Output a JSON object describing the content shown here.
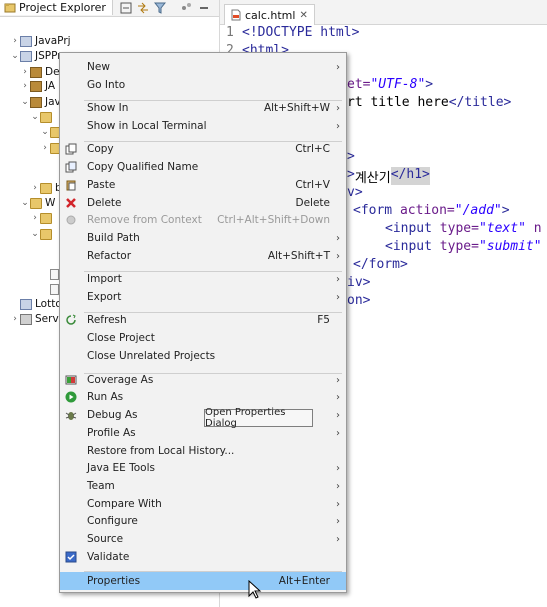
{
  "explorer": {
    "tab_title": "Project Explorer",
    "rows": [
      {
        "twisty": "›",
        "icon": "proj",
        "label": "JavaPrj"
      },
      {
        "twisty": "⌄",
        "icon": "proj",
        "label": "JSPPr"
      },
      {
        "twisty": "›",
        "icon": "pkg",
        "label": "De"
      },
      {
        "twisty": "›",
        "icon": "pkg",
        "label": "JA"
      },
      {
        "twisty": "⌄",
        "icon": "pkg",
        "label": "Jav"
      },
      {
        "twisty": "⌄",
        "icon": "folder",
        "label": ""
      },
      {
        "twisty": "⌄",
        "icon": "folder",
        "label": ""
      },
      {
        "twisty": "›",
        "icon": "folder",
        "label": ""
      },
      {
        "twisty": "›",
        "icon": "folder",
        "label": "bu"
      },
      {
        "twisty": "⌄",
        "icon": "folder",
        "label": "W"
      },
      {
        "twisty": "›",
        "icon": "folder",
        "label": ""
      },
      {
        "twisty": "⌄",
        "icon": "folder",
        "label": ""
      },
      {
        "twisty": "",
        "icon": "file",
        "label": ""
      },
      {
        "twisty": "",
        "icon": "file",
        "label": ""
      },
      {
        "twisty": "",
        "icon": "proj",
        "label": "Lotto"
      },
      {
        "twisty": "›",
        "icon": "server",
        "label": "Serve"
      }
    ]
  },
  "editor": {
    "tab_title": "calc.html",
    "line1_num": "1",
    "line1_text": "<!DOCTYPE html>",
    "line2_num": "2",
    "line2_text": "<html>",
    "charset_attr": "et=",
    "charset_val": "\"UTF-8\"",
    "charset_end": ">",
    "title_text": "rt title here",
    "title_close": "</title>",
    "body_frag": ">",
    "h1_open": ">",
    "h1_text": "계산기",
    "h1_close": "</h1>",
    "div_frag": "v>",
    "form_open": "<form ",
    "form_attr": "action=",
    "form_val": "\"/add\"",
    "form_end": ">",
    "input1_tag": "<input ",
    "input1_attr": "type=",
    "input1_val": "\"text\"",
    "input1_rest": " n",
    "input2_tag": "<input ",
    "input2_attr": "type=",
    "input2_val": "\"submit\"",
    "form_close": "</form>",
    "div_close": "iv>",
    "body_close": "on>"
  },
  "menu": {
    "items": [
      {
        "label": "New",
        "shortcut": "",
        "arrow": true,
        "icon": "",
        "disabled": false
      },
      {
        "label": "Go Into",
        "shortcut": "",
        "arrow": false,
        "icon": "",
        "disabled": false
      },
      {
        "sep": true
      },
      {
        "label": "Show In",
        "shortcut": "Alt+Shift+W",
        "arrow": true,
        "icon": "",
        "disabled": false
      },
      {
        "label": "Show in Local Terminal",
        "shortcut": "",
        "arrow": true,
        "icon": "",
        "disabled": false
      },
      {
        "sep": true
      },
      {
        "label": "Copy",
        "shortcut": "Ctrl+C",
        "arrow": false,
        "icon": "copy-icon",
        "disabled": false
      },
      {
        "label": "Copy Qualified Name",
        "shortcut": "",
        "arrow": false,
        "icon": "copy-qualified-icon",
        "disabled": false
      },
      {
        "label": "Paste",
        "shortcut": "Ctrl+V",
        "arrow": false,
        "icon": "paste-icon",
        "disabled": false
      },
      {
        "label": "Delete",
        "shortcut": "Delete",
        "arrow": false,
        "icon": "delete-icon",
        "disabled": false
      },
      {
        "label": "Remove from Context",
        "shortcut": "Ctrl+Alt+Shift+Down",
        "arrow": false,
        "icon": "remove-context-icon",
        "disabled": true
      },
      {
        "label": "Build Path",
        "shortcut": "",
        "arrow": true,
        "icon": "",
        "disabled": false
      },
      {
        "label": "Refactor",
        "shortcut": "Alt+Shift+T",
        "arrow": true,
        "icon": "",
        "disabled": false
      },
      {
        "sep": true
      },
      {
        "label": "Import",
        "shortcut": "",
        "arrow": true,
        "icon": "",
        "disabled": false
      },
      {
        "label": "Export",
        "shortcut": "",
        "arrow": true,
        "icon": "",
        "disabled": false
      },
      {
        "sep": true
      },
      {
        "label": "Refresh",
        "shortcut": "F5",
        "arrow": false,
        "icon": "refresh-icon",
        "disabled": false
      },
      {
        "label": "Close Project",
        "shortcut": "",
        "arrow": false,
        "icon": "",
        "disabled": false
      },
      {
        "label": "Close Unrelated Projects",
        "shortcut": "",
        "arrow": false,
        "icon": "",
        "disabled": false
      },
      {
        "sep": true
      },
      {
        "label": "Coverage As",
        "shortcut": "",
        "arrow": true,
        "icon": "coverage-icon",
        "disabled": false
      },
      {
        "label": "Run As",
        "shortcut": "",
        "arrow": true,
        "icon": "run-icon",
        "disabled": false
      },
      {
        "label": "Debug As",
        "shortcut": "",
        "arrow": true,
        "icon": "debug-icon",
        "disabled": false
      },
      {
        "label": "Profile As",
        "shortcut": "",
        "arrow": true,
        "icon": "",
        "disabled": false
      },
      {
        "label": "Restore from Local History...",
        "shortcut": "",
        "arrow": false,
        "icon": "",
        "disabled": false
      },
      {
        "label": "Java EE Tools",
        "shortcut": "",
        "arrow": true,
        "icon": "",
        "disabled": false
      },
      {
        "label": "Team",
        "shortcut": "",
        "arrow": true,
        "icon": "",
        "disabled": false
      },
      {
        "label": "Compare With",
        "shortcut": "",
        "arrow": true,
        "icon": "",
        "disabled": false
      },
      {
        "label": "Configure",
        "shortcut": "",
        "arrow": true,
        "icon": "",
        "disabled": false
      },
      {
        "label": "Source",
        "shortcut": "",
        "arrow": true,
        "icon": "",
        "disabled": false
      },
      {
        "label": "Validate",
        "shortcut": "",
        "arrow": false,
        "icon": "validate-icon",
        "disabled": false
      },
      {
        "sep": true
      },
      {
        "label": "Properties",
        "shortcut": "Alt+Enter",
        "arrow": false,
        "icon": "",
        "disabled": false,
        "selected": true
      }
    ],
    "tooltip": "Open Properties Dialog"
  }
}
